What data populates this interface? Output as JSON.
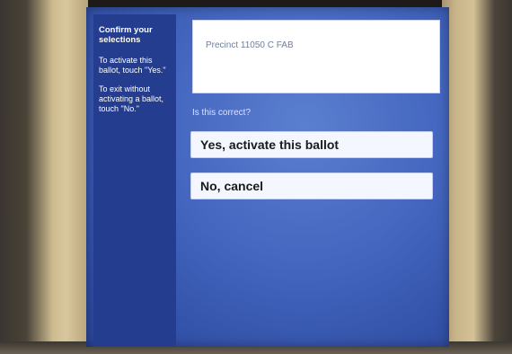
{
  "sidebar": {
    "title": "Confirm your selections",
    "instruction_yes": "To activate this ballot, touch \"Yes.\"",
    "instruction_no": "To exit without activating a ballot, touch \"No.\""
  },
  "precinct": {
    "text": "Precinct 11050 C FAB"
  },
  "question": "Is this correct?",
  "choices": {
    "yes_label": "Yes, activate this ballot",
    "no_label": "No, cancel"
  },
  "colors": {
    "screen_blue": "#4466bf",
    "sidebar_blue": "#243d8e",
    "button_bg": "#f4f7ff"
  }
}
